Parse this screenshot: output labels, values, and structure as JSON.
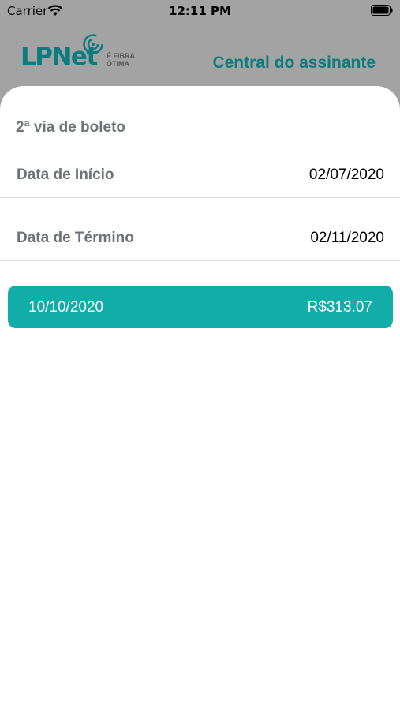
{
  "status_bar": {
    "carrier": "Carrier",
    "time": "12:11 PM"
  },
  "header": {
    "logo_text": "LPNet",
    "logo_tagline": "É FIBRA ÓTIMA",
    "title": "Central do assinante"
  },
  "screen": {
    "title": "2ª via de boleto",
    "fields": [
      {
        "label": "Data de Início",
        "value": "02/07/2020"
      },
      {
        "label": "Data de Término",
        "value": "02/11/2020"
      }
    ],
    "boletos": [
      {
        "date": "10/10/2020",
        "amount": "R$313.07"
      }
    ]
  },
  "colors": {
    "brand_teal": "#0a7b7f",
    "card_teal": "#12aca9",
    "overlay_gray": "#a3a3a3",
    "label_gray": "#6d7378"
  }
}
